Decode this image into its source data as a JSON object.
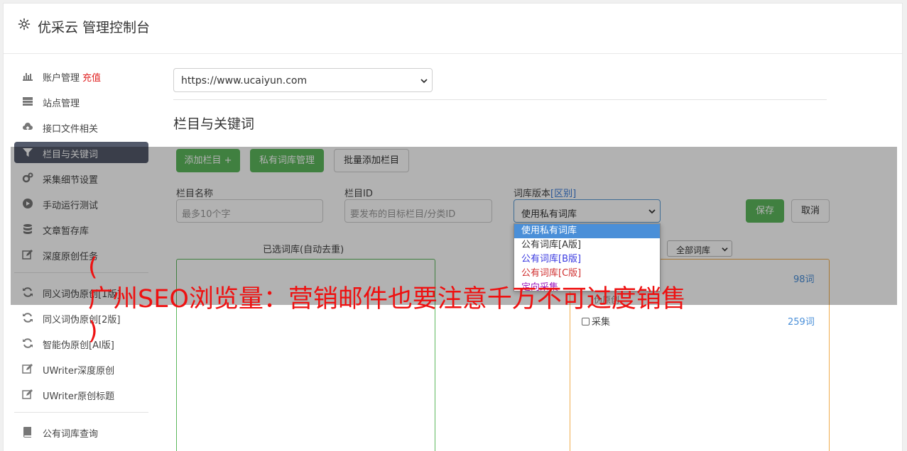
{
  "header": {
    "title": "优采云 管理控制台",
    "icon": "gear-icon"
  },
  "sidebar": {
    "items": [
      {
        "label": "账户管理",
        "extra": "充值",
        "icon": "bar-chart-icon"
      },
      {
        "label": "站点管理",
        "icon": "server-icon"
      },
      {
        "label": "接口文件相关",
        "icon": "cloud-upload-icon"
      },
      {
        "label": "栏目与关键词",
        "icon": "filter-icon",
        "active": true
      },
      {
        "label": "采集细节设置",
        "icon": "gears-icon"
      },
      {
        "label": "手动运行测试",
        "icon": "play-circle-icon"
      },
      {
        "label": "文章暂存库",
        "icon": "database-icon"
      },
      {
        "label": "深度原创任务",
        "icon": "edit-icon"
      },
      {
        "label": "同义词伪原创[1版]",
        "icon": "refresh-icon"
      },
      {
        "label": "同义词伪原创[2版]",
        "icon": "refresh-icon"
      },
      {
        "label": "智能伪原创[AI版]",
        "icon": "refresh-icon"
      },
      {
        "label": "UWriter深度原创",
        "icon": "edit-icon"
      },
      {
        "label": "UWriter原创标题",
        "icon": "edit-icon"
      },
      {
        "label": "公有词库查询",
        "icon": "book-icon"
      }
    ]
  },
  "main": {
    "site_select": {
      "value": "https://www.ucaiyun.com"
    },
    "section_title": "栏目与关键词",
    "buttons": {
      "add_column": "添加栏目 +",
      "private_lexicon": "私有词库管理",
      "batch_add": "批量添加栏目",
      "save": "保存",
      "cancel": "取消"
    },
    "form": {
      "column_name_label": "栏目名称",
      "column_name_placeholder": "最多10个字",
      "column_id_label": "栏目ID",
      "column_id_placeholder": "要发布的目标栏目/分类ID",
      "lexicon_version_label": "词库版本",
      "lexicon_version_tag": "[区别]",
      "lexicon_version_value": "使用私有词库",
      "lexicon_options": [
        "使用私有词库",
        "公有词库[A版]",
        "公有词库[B版]",
        "公有词库[C版]",
        "定向采集"
      ]
    },
    "selected_panel": {
      "title": "已选词库(自动去重)"
    },
    "right_panel": {
      "filter_value": "全部词库",
      "partial_label": "伪原创",
      "count_1": "98词",
      "count_2": "259词",
      "checkbox_label": "采集"
    }
  },
  "banner": {
    "open": "(",
    "text": "广州SEO浏览量：营销邮件也要注意千万不可过度销售",
    "close": ")",
    "color": "#ee1111"
  },
  "colors": {
    "green": "#5cb85c",
    "active_nav": "#535a6b",
    "recharge": "#e02020",
    "link_blue": "#4a8fd8",
    "orange_border": "#f0ad4e"
  }
}
